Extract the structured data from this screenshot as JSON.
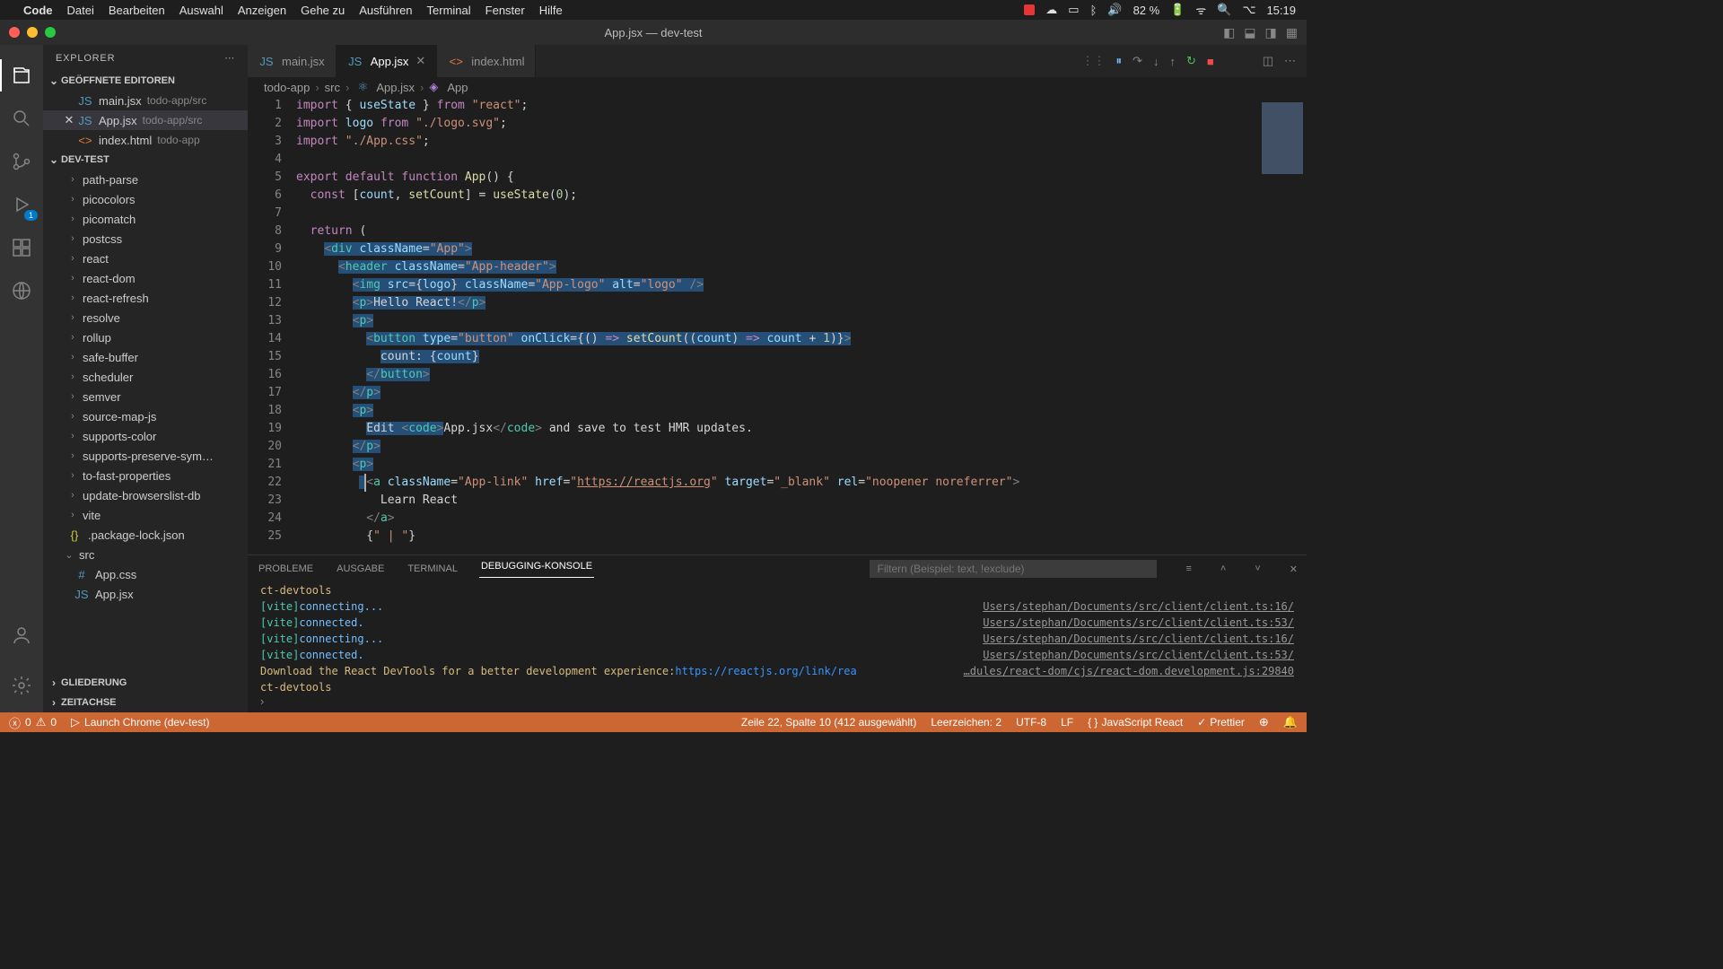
{
  "macos": {
    "app": "Code",
    "menu": [
      "Datei",
      "Bearbeiten",
      "Auswahl",
      "Anzeigen",
      "Gehe zu",
      "Ausführen",
      "Terminal",
      "Fenster",
      "Hilfe"
    ],
    "battery": "82 %",
    "clock": "15:19"
  },
  "window": {
    "title": "App.jsx — dev-test"
  },
  "sidebar": {
    "title": "EXPLORER",
    "openEditors": {
      "title": "GEÖFFNETE EDITOREN",
      "items": [
        {
          "name": "main.jsx",
          "dir": "todo-app/src",
          "icon": "jsx"
        },
        {
          "name": "App.jsx",
          "dir": "todo-app/src",
          "icon": "jsx",
          "active": true,
          "showClose": true
        },
        {
          "name": "index.html",
          "dir": "todo-app",
          "icon": "html"
        }
      ]
    },
    "project": {
      "title": "DEV-TEST",
      "folders": [
        "path-parse",
        "picocolors",
        "picomatch",
        "postcss",
        "react",
        "react-dom",
        "react-refresh",
        "resolve",
        "rollup",
        "safe-buffer",
        "scheduler",
        "semver",
        "source-map-js",
        "supports-color",
        "supports-preserve-sym…",
        "to-fast-properties",
        "update-browserslist-db",
        "vite"
      ],
      "files": [
        {
          "name": ".package-lock.json",
          "icon": "json",
          "indent": 1
        }
      ],
      "src": {
        "name": "src",
        "files": [
          {
            "name": "App.css",
            "icon": "css"
          },
          {
            "name": "App.jsx",
            "icon": "jsx",
            "active": true
          }
        ]
      }
    },
    "outline": "GLIEDERUNG",
    "timeline": "ZEITACHSE"
  },
  "tabs": [
    {
      "name": "main.jsx",
      "icon": "jsx"
    },
    {
      "name": "App.jsx",
      "icon": "jsx",
      "active": true
    },
    {
      "name": "index.html",
      "icon": "html"
    }
  ],
  "breadcrumb": [
    "todo-app",
    "src",
    "App.jsx",
    "App"
  ],
  "activity_badge": "1",
  "code": {
    "lines": 25
  },
  "cursor": {
    "line": 22,
    "col": 10
  },
  "panel": {
    "tabs": [
      "PROBLEME",
      "AUSGABE",
      "TERMINAL",
      "DEBUGGING-KONSOLE"
    ],
    "activeTab": 3,
    "filterPlaceholder": "Filtern (Beispiel: text, !exclude)",
    "lines": [
      {
        "text": "ct-devtools",
        "cls": "con-warn"
      },
      {
        "pre": "[vite]",
        "text": " connecting...",
        "cls": "con-info",
        "loc": "Users/stephan/Documents/src/client/client.ts:16/"
      },
      {
        "pre": "[vite]",
        "text": " connected.",
        "cls": "con-info",
        "loc": "Users/stephan/Documents/src/client/client.ts:53/"
      },
      {
        "pre": "[vite]",
        "text": " connecting...",
        "cls": "con-info",
        "loc": "Users/stephan/Documents/src/client/client.ts:16/"
      },
      {
        "pre": "[vite]",
        "text": " connected.",
        "cls": "con-info",
        "loc": "Users/stephan/Documents/src/client/client.ts:53/"
      },
      {
        "text": "Download the React DevTools for a better development experience: ",
        "link": "https://reactjs.org/link/rea",
        "loc": "…dules/react-dom/cjs/react-dom.development.js:29840",
        "cls": "con-warn"
      },
      {
        "text": "ct-devtools",
        "cls": "con-warn"
      }
    ]
  },
  "status": {
    "errors": "0",
    "warnings": "0",
    "launch": "Launch Chrome (dev-test)",
    "pos": "Zeile 22, Spalte 10 (412 ausgewählt)",
    "spaces": "Leerzeichen: 2",
    "encoding": "UTF-8",
    "eol": "LF",
    "lang": "JavaScript React",
    "prettier": "Prettier"
  }
}
